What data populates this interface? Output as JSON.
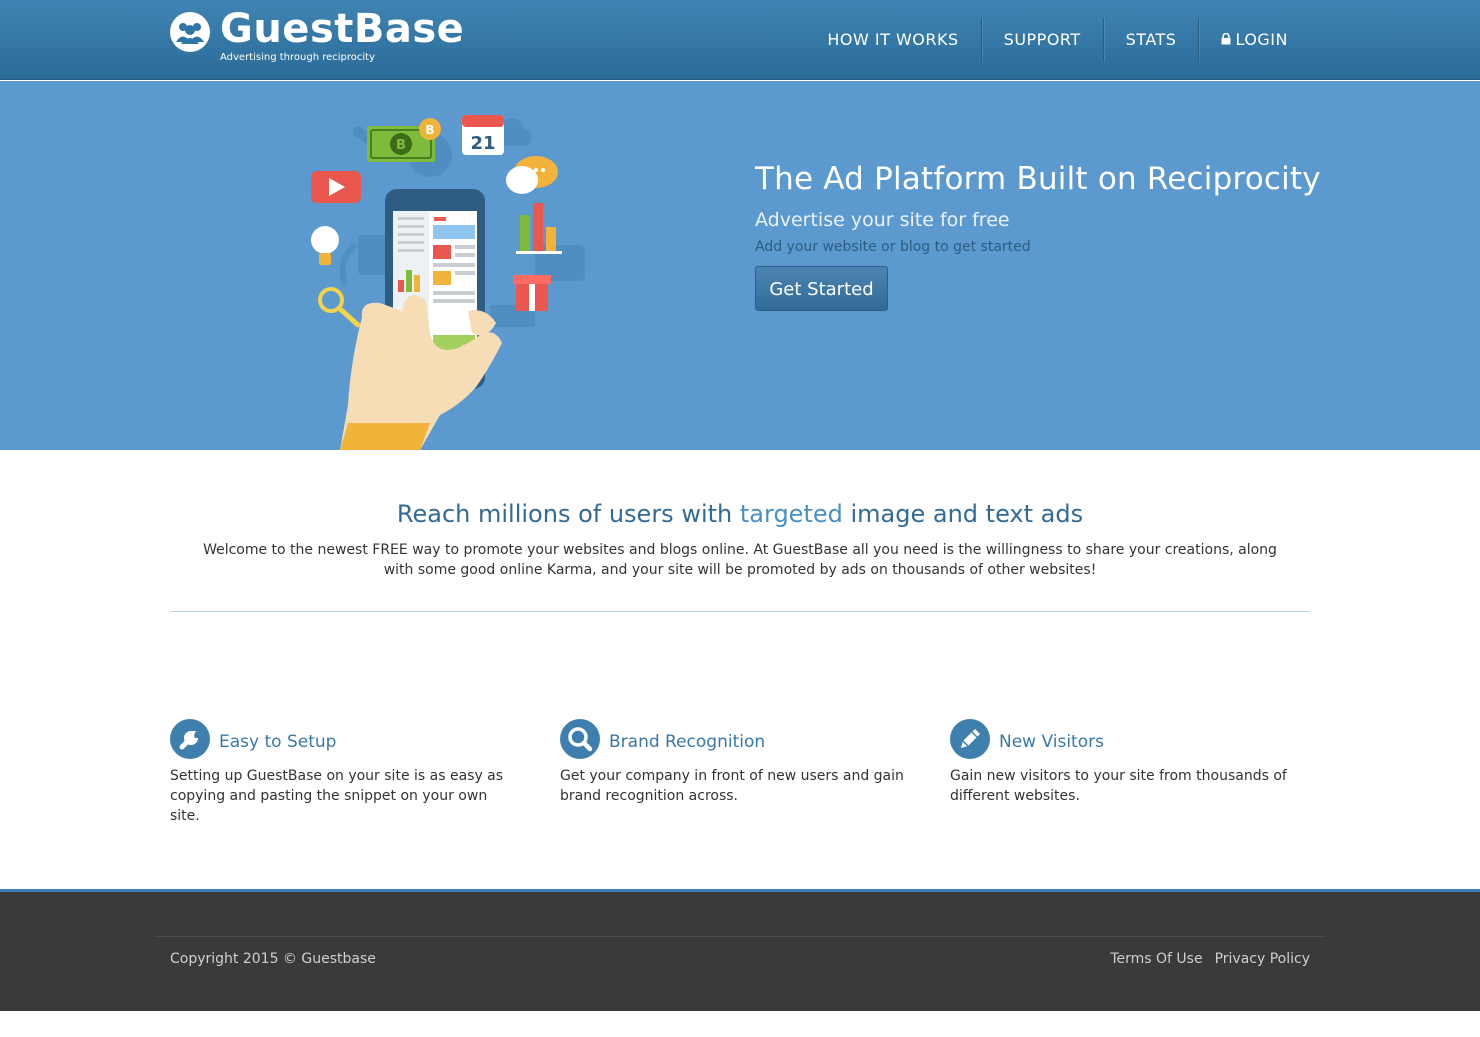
{
  "header": {
    "logo_title": "GuestBase",
    "logo_tagline": "Advertising through reciprocity",
    "logo_icon": "users-icon",
    "nav": [
      {
        "label": "HOW IT WORKS"
      },
      {
        "label": "SUPPORT"
      },
      {
        "label": "STATS"
      },
      {
        "label": "LOGIN",
        "icon": "lock-icon"
      }
    ]
  },
  "hero": {
    "title": "The Ad Platform Built on Reciprocity",
    "subtitle": "Advertise your site for free",
    "subtext": "Add your website or blog to get started",
    "cta_label": "Get Started",
    "illustration_calendar_day": "21"
  },
  "intro": {
    "title_before": "Reach millions of users with ",
    "title_accent": "targeted",
    "title_after": " image and text ads",
    "body": "Welcome to the newest FREE way to promote your websites and blogs online. At GuestBase all you need is the willingness to share your creations, along with some good online Karma, and your site will be promoted by ads on thousands of other websites!"
  },
  "features": [
    {
      "icon": "wrench-icon",
      "title": "Easy to Setup",
      "text": "Setting up GuestBase on your site is as easy as copying and pasting the snippet on your own site."
    },
    {
      "icon": "search-icon",
      "title": "Brand Recognition",
      "text": "Get your company in front of new users and gain brand recognition across."
    },
    {
      "icon": "pencil-icon",
      "title": "New Visitors",
      "text": "Gain new visitors to your site from thousands of different websites."
    }
  ],
  "footer": {
    "copyright": "Copyright 2015 © Guestbase",
    "links": [
      {
        "label": "Terms Of Use"
      },
      {
        "label": "Privacy Policy"
      }
    ]
  },
  "colors": {
    "header": "#2f74a4",
    "hero": "#5b99cf",
    "accent": "#3e7fae",
    "footer": "#3a3a3a"
  }
}
